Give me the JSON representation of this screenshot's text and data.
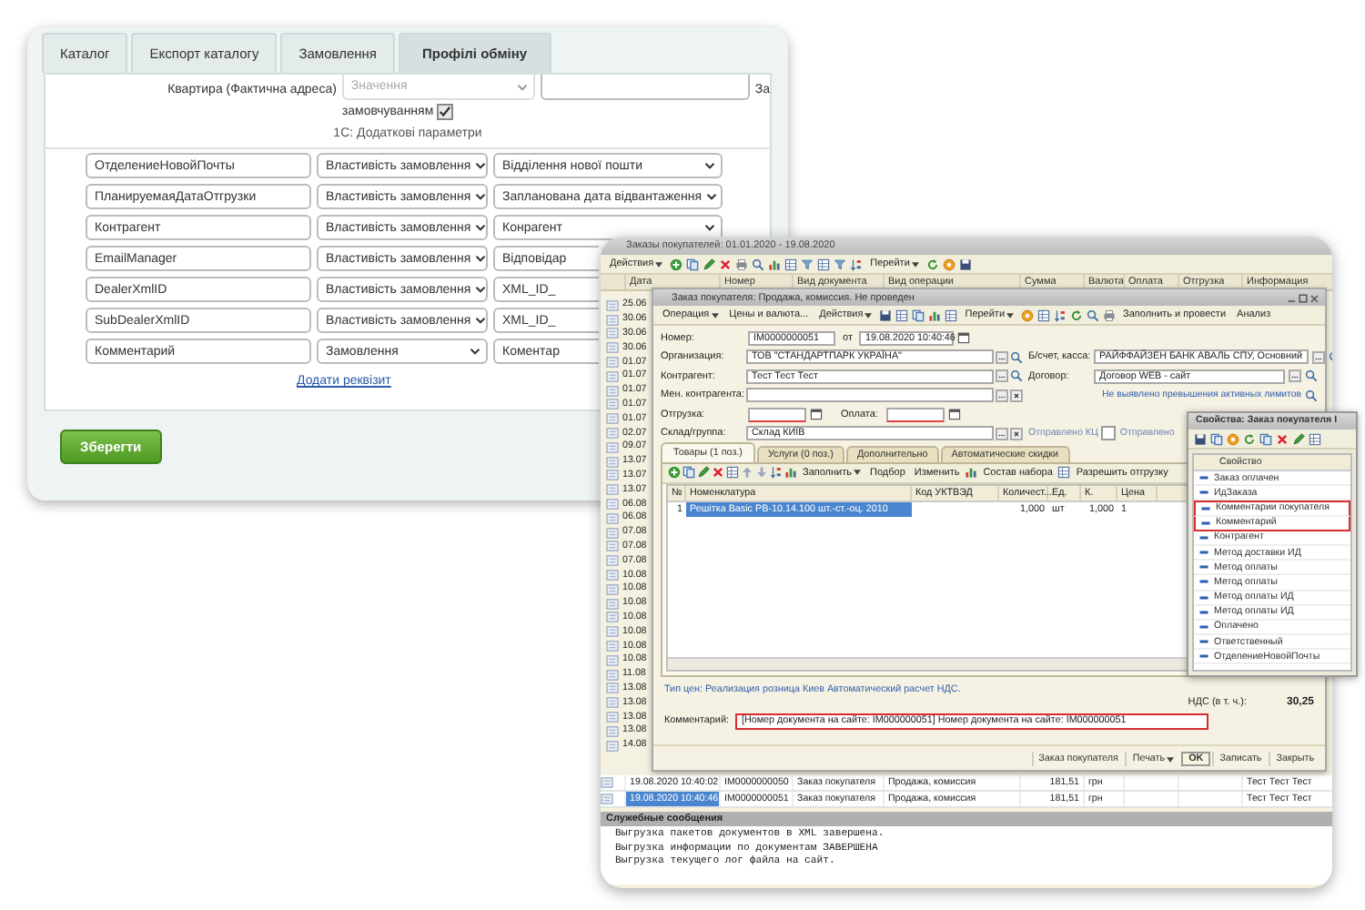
{
  "settings_page": {
    "tabs": [
      {
        "label": "Каталог",
        "selected": false
      },
      {
        "label": "Експорт каталогу",
        "selected": false
      },
      {
        "label": "Замовлення",
        "selected": false
      },
      {
        "label": "Профілі обміну",
        "selected": true
      }
    ],
    "address_row": {
      "label": "Квартира (Фактична адреса)",
      "select_placeholder": "Значення",
      "default_label_start": "За",
      "default_label_end": "замовчуванням",
      "default_checked": true
    },
    "section_title": "1С: Додаткові параметри",
    "params": [
      {
        "name": "ОтделениеНовойПочты",
        "type": "Властивість замовлення",
        "value": "Відділення нової пошти"
      },
      {
        "name": "ПланируемаяДатаОтгрузки",
        "type": "Властивість замовлення",
        "value": "Запланована дата відвантаження"
      },
      {
        "name": "Контрагент",
        "type": "Властивість замовлення",
        "value": "Конрагент"
      },
      {
        "name": "EmailManager",
        "type": "Властивість замовлення",
        "value": "Відповідар"
      },
      {
        "name": "DealerXmlID",
        "type": "Властивість замовлення",
        "value": "XML_ID_"
      },
      {
        "name": "SubDealerXmlID",
        "type": "Властивість замовлення",
        "value": "XML_ID_"
      },
      {
        "name": "Комментарий",
        "type": "Замовлення",
        "value": "Коментар"
      }
    ],
    "add_link": "Додати реквізит",
    "save_button": "Зберегти"
  },
  "orders_window": {
    "title": "Заказы покупателей: 01.01.2020 - 19.08.2020",
    "toolbar": [
      {
        "label": "Действия",
        "dropdown": true
      },
      {
        "label": "Перейти",
        "dropdown": true
      }
    ],
    "columns": [
      "Дата",
      "Номер",
      "Вид документа",
      "Вид операции",
      "Сумма",
      "Валюта",
      "Оплата",
      "Отгрузка",
      "Информация"
    ],
    "date_rows": [
      "25.06",
      "30.06",
      "30.06",
      "30.06",
      "01.07",
      "01.07",
      "01.07",
      "01.07",
      "01.07",
      "02.07",
      "09.07",
      "13.07",
      "13.07",
      "13.07",
      "06.08",
      "06.08",
      "07.08",
      "07.08",
      "07.08",
      "10.08",
      "10.08",
      "10.08",
      "10.08",
      "10.08",
      "10.08",
      "10.08",
      "11.08",
      "13.08",
      "13.08",
      "13.08",
      "13.08",
      "14.08"
    ],
    "rows": [
      {
        "date": "19.08.2020 10:40:02",
        "number": "IM0000000050",
        "doc_type": "Заказ покупателя",
        "operation": "Продажа, комиссия",
        "amount": "181,51",
        "currency": "грн",
        "info": "Тест Тест Тест",
        "selected": false
      },
      {
        "date": "19.08.2020 10:40:46",
        "number": "IM0000000051",
        "doc_type": "Заказ покупателя",
        "operation": "Продажа, комиссия",
        "amount": "181,51",
        "currency": "грн",
        "info": "Тест Тест Тест",
        "selected": true
      }
    ]
  },
  "order_form": {
    "title": "Заказ покупателя: Продажа, комиссия. Не проведен",
    "toolbar": [
      {
        "label": "Операция",
        "dropdown": true
      },
      {
        "label": "Цены и валюта...",
        "dropdown": false
      },
      {
        "label": "Действия",
        "dropdown": true
      },
      {
        "label": "Перейти",
        "dropdown": true
      },
      {
        "label": "Заполнить и провести",
        "dropdown": false
      },
      {
        "label": "Анализ",
        "dropdown": false
      }
    ],
    "number_label": "Номер:",
    "number": "IM0000000051",
    "date_label": "от",
    "date": "19.08.2020 10:40:46",
    "left_fields": [
      {
        "label": "Организация:",
        "value": "ТОВ \"СТАНДАРТПАРК УКРАЇНА\""
      },
      {
        "label": "Контрагент:",
        "value": "Тест Тест Тест"
      },
      {
        "label": "Мен. контрагента:"
      }
    ],
    "right_fields": [
      {
        "label": "Б/счет, касса:",
        "value": "РАЙФФАЙЗЕН БАНК АВАЛЬ СПУ, Основний"
      },
      {
        "label": "Договор:",
        "value": "Договор WEB - сайт"
      }
    ],
    "limits_note": "Не выявлено превышения активных лимитов",
    "shipment_label": "Отгрузка:",
    "payment_label": "Оплата:",
    "warehouse_label": "Склад/группа:",
    "warehouse": "Склад КИЇВ",
    "sent_label": "Отправлено КЦ",
    "sent_checkbox_label": "Отправлено",
    "sent_checked": false,
    "tabs": [
      {
        "label": "Товары (1 поз.)",
        "selected": true
      },
      {
        "label": "Услуги (0 поз.)",
        "selected": false
      },
      {
        "label": "Дополнительно",
        "selected": false
      },
      {
        "label": "Автоматические скидки",
        "selected": false
      }
    ],
    "table_toolbar": [
      {
        "label": "Заполнить",
        "dropdown": true
      },
      {
        "label": "Подбор",
        "dropdown": false
      },
      {
        "label": "Изменить",
        "dropdown": false
      },
      {
        "label": "Состав набора",
        "dropdown": false
      },
      {
        "label": "Разрешить отгрузку",
        "dropdown": false
      }
    ],
    "columns": [
      "№",
      "Номенклатура",
      "Код УКТВЭД",
      "Количест...",
      "Ед.",
      "К.",
      "Цена"
    ],
    "rows": [
      {
        "n": "1",
        "item": "Решітка Basic PB-10.14.100 шт.-ст.-оц. 2010",
        "qty": "1,000",
        "unit": "шт",
        "k": "1,000",
        "price": "1",
        "selected": true
      }
    ],
    "price_type": "Тип цен: Реализация розница Киев Автоматический расчет НДС.",
    "vat_label": "НДС (в т. ч.):",
    "vat": "30,25",
    "comment_label": "Комментарий:",
    "comment": "[Номер документа на сайте: IM000000051] Номер документа на сайте: IM000000051",
    "comment_highlighted": true,
    "footer": [
      {
        "label": "Заказ покупателя",
        "dropdown": false,
        "default": false
      },
      {
        "label": "Печать",
        "dropdown": true,
        "default": false
      },
      {
        "label": "OK",
        "dropdown": false,
        "default": true
      },
      {
        "label": "Записать",
        "dropdown": false,
        "default": false
      },
      {
        "label": "Закрыть",
        "dropdown": false,
        "default": false
      }
    ]
  },
  "properties_window": {
    "title": "Свойства: Заказ покупателя I",
    "column": "Свойство",
    "items": [
      {
        "label": "Заказ оплачен",
        "highlighted": false
      },
      {
        "label": "ИдЗаказа",
        "highlighted": false
      },
      {
        "label": "Комментарии покупателя",
        "highlighted": true
      },
      {
        "label": "Комментарий",
        "highlighted": true
      },
      {
        "label": "Контрагент",
        "highlighted": false
      },
      {
        "label": "Метод доставки ИД",
        "highlighted": false
      },
      {
        "label": "Метод оплаты",
        "highlighted": false
      },
      {
        "label": "Метод оплаты",
        "highlighted": false
      },
      {
        "label": "Метод оплаты ИД",
        "highlighted": false
      },
      {
        "label": "Метод оплаты ИД",
        "highlighted": false
      },
      {
        "label": "Оплачено",
        "highlighted": false
      },
      {
        "label": "Ответственный",
        "highlighted": false
      },
      {
        "label": "ОтделениеНовойПочты",
        "highlighted": false
      }
    ]
  },
  "messages": {
    "title": "Служебные сообщения",
    "lines": [
      "Выгрузка пакетов документов в XML завершена.",
      "Выгрузка информации по документам ЗАВЕРШЕНА",
      "Выгрузка текущего лог файла на сайт."
    ]
  }
}
